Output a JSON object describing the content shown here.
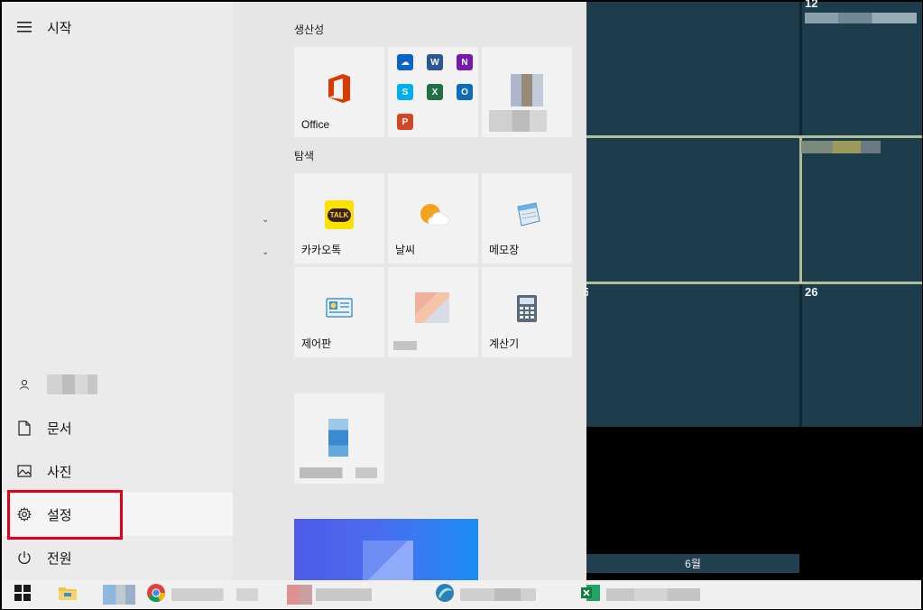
{
  "start_menu": {
    "title": "시작",
    "user": {
      "name": ""
    },
    "rail_items": [
      {
        "id": "docs",
        "label": "문서"
      },
      {
        "id": "pictures",
        "label": "사진"
      },
      {
        "id": "settings",
        "label": "설정"
      },
      {
        "id": "power",
        "label": "전원"
      }
    ]
  },
  "tile_groups": [
    {
      "title": "생산성"
    },
    {
      "title": "탐색"
    }
  ],
  "tiles": {
    "office": {
      "label": "Office"
    },
    "kakaotalk": {
      "label": "카카오톡",
      "icon_text": "TALK"
    },
    "weather": {
      "label": "날씨"
    },
    "notepad": {
      "label": "메모장"
    },
    "control_panel": {
      "label": "제어판"
    },
    "calculator": {
      "label": "계산기"
    }
  },
  "office_apps": [
    {
      "name": "onedrive-icon",
      "color": "#0a64c8",
      "glyph": "☁"
    },
    {
      "name": "word-icon",
      "color": "#2b5797",
      "glyph": "W"
    },
    {
      "name": "onenote-icon",
      "color": "#7719aa",
      "glyph": "N"
    },
    {
      "name": "skype-icon",
      "color": "#00aff0",
      "glyph": "S"
    },
    {
      "name": "excel-icon",
      "color": "#1e7145",
      "glyph": "X"
    },
    {
      "name": "outlook-icon",
      "color": "#0f6cbd",
      "glyph": "O"
    },
    {
      "name": "powerpoint-icon",
      "color": "#d24726",
      "glyph": "P"
    }
  ],
  "desktop": {
    "day_numbers": [
      "12",
      "26",
      "5"
    ],
    "month_label": "6월"
  },
  "colors": {
    "highlight_box": "#e0001b",
    "start_rail_bg": "#ebebeb",
    "tiles_bg": "#e6e6e6",
    "tile_bg": "#f2f2f2",
    "desktop_bg": "#1e3d4c"
  }
}
